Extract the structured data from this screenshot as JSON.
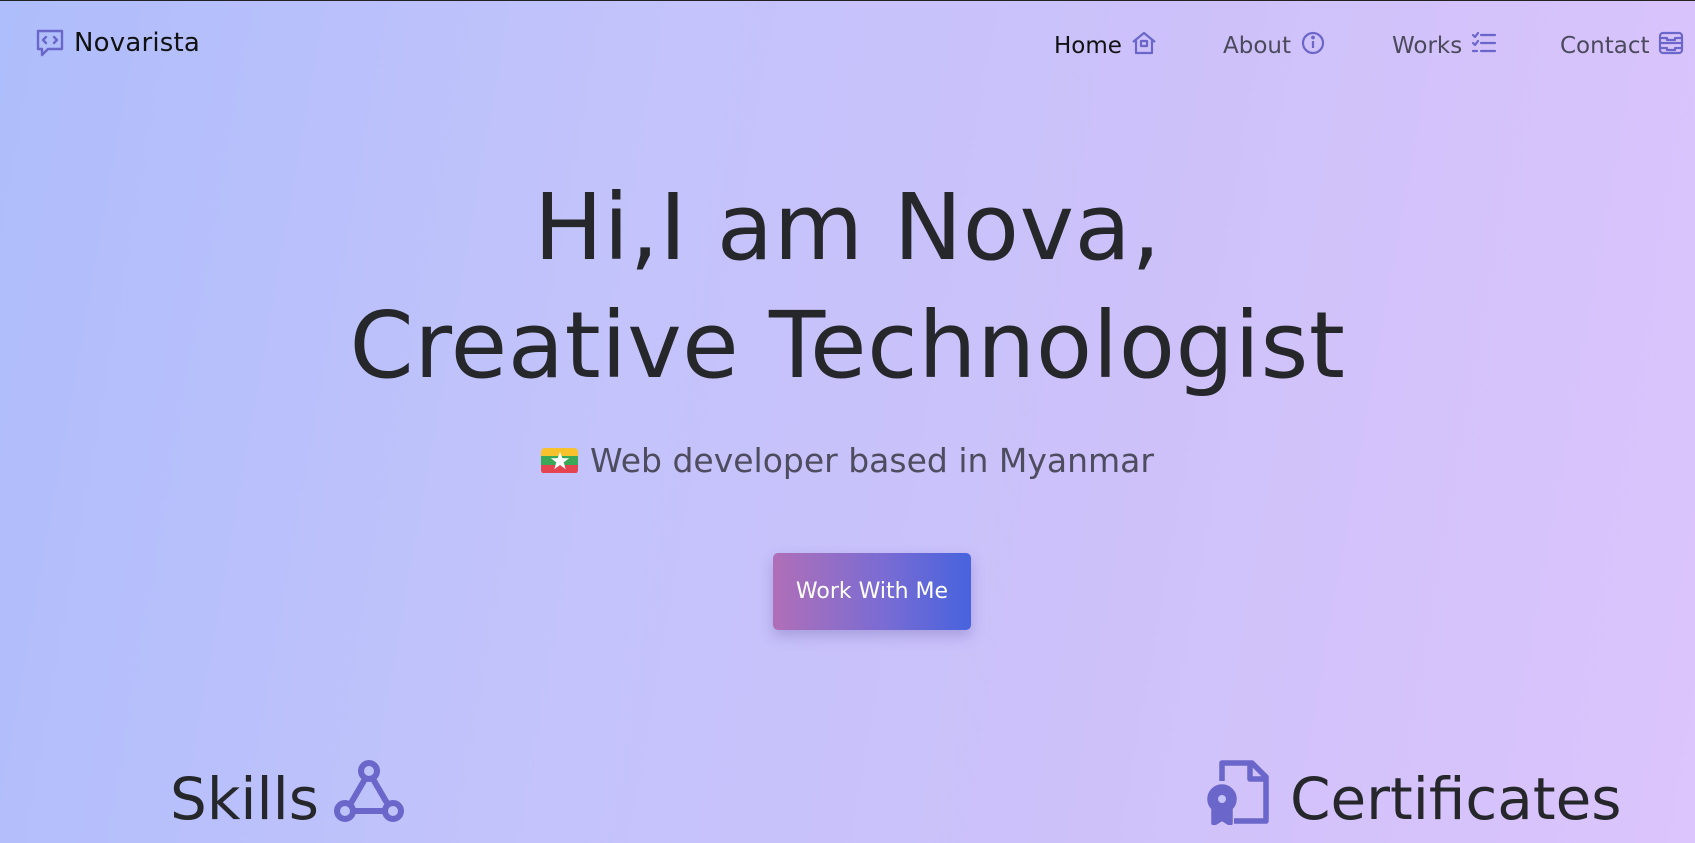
{
  "brand": {
    "name": "Novarista",
    "icon": "code-chat-icon"
  },
  "nav": {
    "home": {
      "label": "Home",
      "icon": "house-icon"
    },
    "about": {
      "label": "About",
      "icon": "info-circle-icon"
    },
    "works": {
      "label": "Works",
      "icon": "list-check-icon"
    },
    "contact": {
      "label": "Contact",
      "icon": "inbox-stack-icon"
    }
  },
  "hero": {
    "line1": "Hi,I am Nova,",
    "line2": "Creative Technologist",
    "tagline": "Web developer based in Myanmar",
    "flag": "myanmar-flag-icon",
    "cta_label": "Work With Me"
  },
  "sections": {
    "skills": {
      "title": "Skills",
      "icon": "share-nodes-icon"
    },
    "certificates": {
      "title": "Certificates",
      "icon": "file-certificate-icon"
    }
  },
  "colors": {
    "accent_icon": "#6b66c9",
    "text_dark": "#25272b",
    "text_muted": "#4b4a5c",
    "cta_gradient_start": "#b06fb7",
    "cta_gradient_end": "#4763dd"
  }
}
